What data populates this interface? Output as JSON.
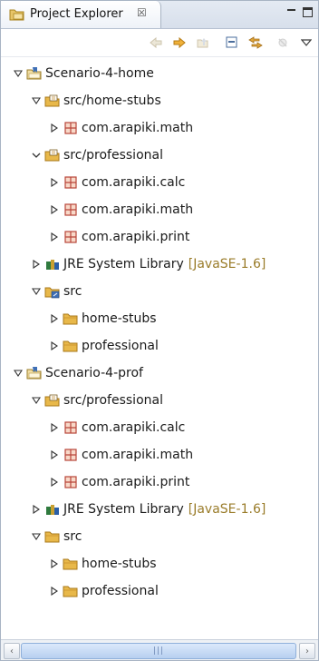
{
  "view": {
    "title": "Project Explorer",
    "close_glyph": "☒"
  },
  "toolbar": {
    "buttons": [
      {
        "name": "back-icon",
        "enabled": false
      },
      {
        "name": "forward-icon",
        "enabled": true
      },
      {
        "name": "up-icon",
        "enabled": false
      },
      {
        "name": "collapse-all-icon",
        "enabled": true
      },
      {
        "name": "link-with-editor-icon",
        "enabled": true
      },
      {
        "name": "filter-icon",
        "enabled": false
      },
      {
        "name": "view-menu-icon",
        "enabled": true
      }
    ]
  },
  "tree": [
    {
      "level": 0,
      "twisty": "expanded",
      "icon": "project-icon",
      "label": "Scenario-4-home"
    },
    {
      "level": 1,
      "twisty": "expanded",
      "icon": "source-folder-icon",
      "label": "src/home-stubs"
    },
    {
      "level": 2,
      "twisty": "collapsed",
      "icon": "package-icon",
      "label": "com.arapiki.math"
    },
    {
      "level": 1,
      "twisty": "expanded-alt",
      "icon": "source-folder-icon",
      "label": "src/professional"
    },
    {
      "level": 2,
      "twisty": "collapsed",
      "icon": "package-icon",
      "label": "com.arapiki.calc"
    },
    {
      "level": 2,
      "twisty": "collapsed",
      "icon": "package-icon",
      "label": "com.arapiki.math"
    },
    {
      "level": 2,
      "twisty": "collapsed",
      "icon": "package-icon",
      "label": "com.arapiki.print"
    },
    {
      "level": 1,
      "twisty": "collapsed",
      "icon": "library-icon",
      "label": "JRE System Library",
      "decoration": "[JavaSE-1.6]"
    },
    {
      "level": 1,
      "twisty": "expanded",
      "icon": "linked-folder-icon",
      "label": "src"
    },
    {
      "level": 2,
      "twisty": "collapsed",
      "icon": "folder-icon",
      "label": "home-stubs"
    },
    {
      "level": 2,
      "twisty": "collapsed",
      "icon": "folder-icon",
      "label": "professional"
    },
    {
      "level": 0,
      "twisty": "expanded",
      "icon": "project-icon",
      "label": "Scenario-4-prof"
    },
    {
      "level": 1,
      "twisty": "expanded",
      "icon": "source-folder-icon",
      "label": "src/professional"
    },
    {
      "level": 2,
      "twisty": "collapsed",
      "icon": "package-icon",
      "label": "com.arapiki.calc"
    },
    {
      "level": 2,
      "twisty": "collapsed",
      "icon": "package-icon",
      "label": "com.arapiki.math"
    },
    {
      "level": 2,
      "twisty": "collapsed",
      "icon": "package-icon",
      "label": "com.arapiki.print"
    },
    {
      "level": 1,
      "twisty": "collapsed",
      "icon": "library-icon",
      "label": "JRE System Library",
      "decoration": "[JavaSE-1.6]"
    },
    {
      "level": 1,
      "twisty": "expanded",
      "icon": "folder-icon",
      "label": "src"
    },
    {
      "level": 2,
      "twisty": "collapsed",
      "icon": "folder-icon",
      "label": "home-stubs"
    },
    {
      "level": 2,
      "twisty": "collapsed",
      "icon": "folder-icon",
      "label": "professional"
    }
  ],
  "scrollbar": {
    "left_arrow": "‹",
    "right_arrow": "›",
    "grip": "|||"
  },
  "colors": {
    "folder": "#e8b84a",
    "package": "#b8453a",
    "library_book": "#2f7a3e",
    "decoration": "#9a7c2a",
    "accent": "#6f8fc4"
  }
}
